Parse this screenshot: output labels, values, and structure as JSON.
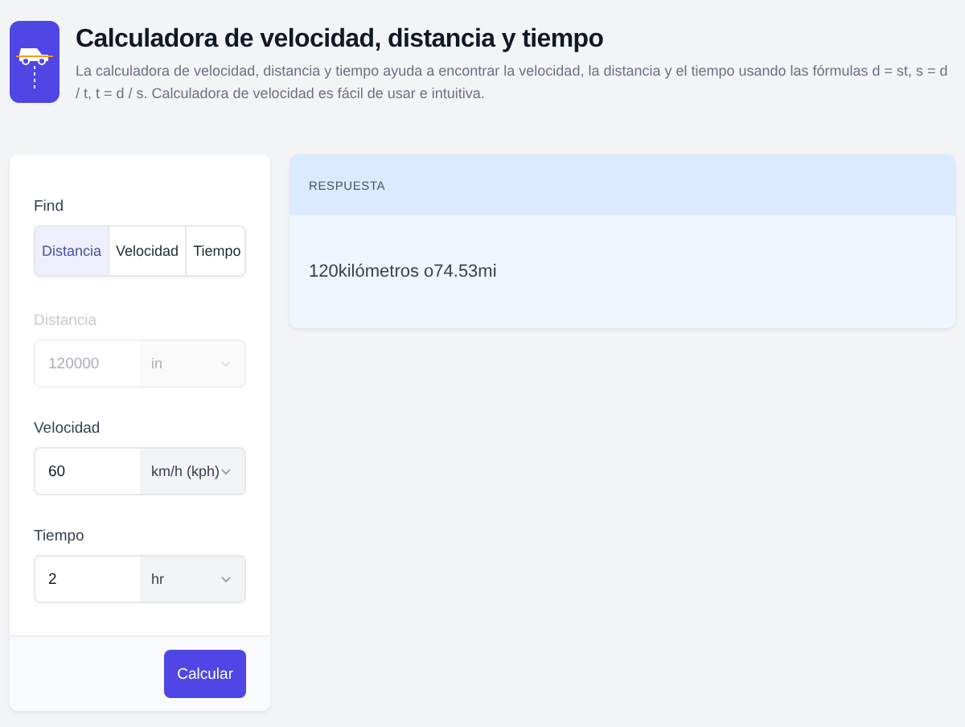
{
  "header": {
    "title": "Calculadora de velocidad, distancia y tiempo",
    "description": "La calculadora de velocidad, distancia y tiempo ayuda a encontrar la velocidad, la distancia y el tiempo usando las fórmulas d = st, s = d / t, t = d / s. Calculadora de velocidad es fácil de usar e intuitiva."
  },
  "form": {
    "find_label": "Find",
    "tabs": [
      {
        "label": "Distancia",
        "selected": true
      },
      {
        "label": "Velocidad",
        "selected": false
      },
      {
        "label": "Tiempo",
        "selected": false
      }
    ],
    "fields": [
      {
        "label": "Distancia",
        "value": "120000",
        "unit": "in",
        "disabled": true
      },
      {
        "label": "Velocidad",
        "value": "60",
        "unit": "km/h (kph)",
        "disabled": false
      },
      {
        "label": "Tiempo",
        "value": "2",
        "unit": "hr",
        "disabled": false
      }
    ],
    "button": "Calcular"
  },
  "answer": {
    "heading": "RESPUESTA",
    "text": "120kilómetros o74.53mi"
  }
}
